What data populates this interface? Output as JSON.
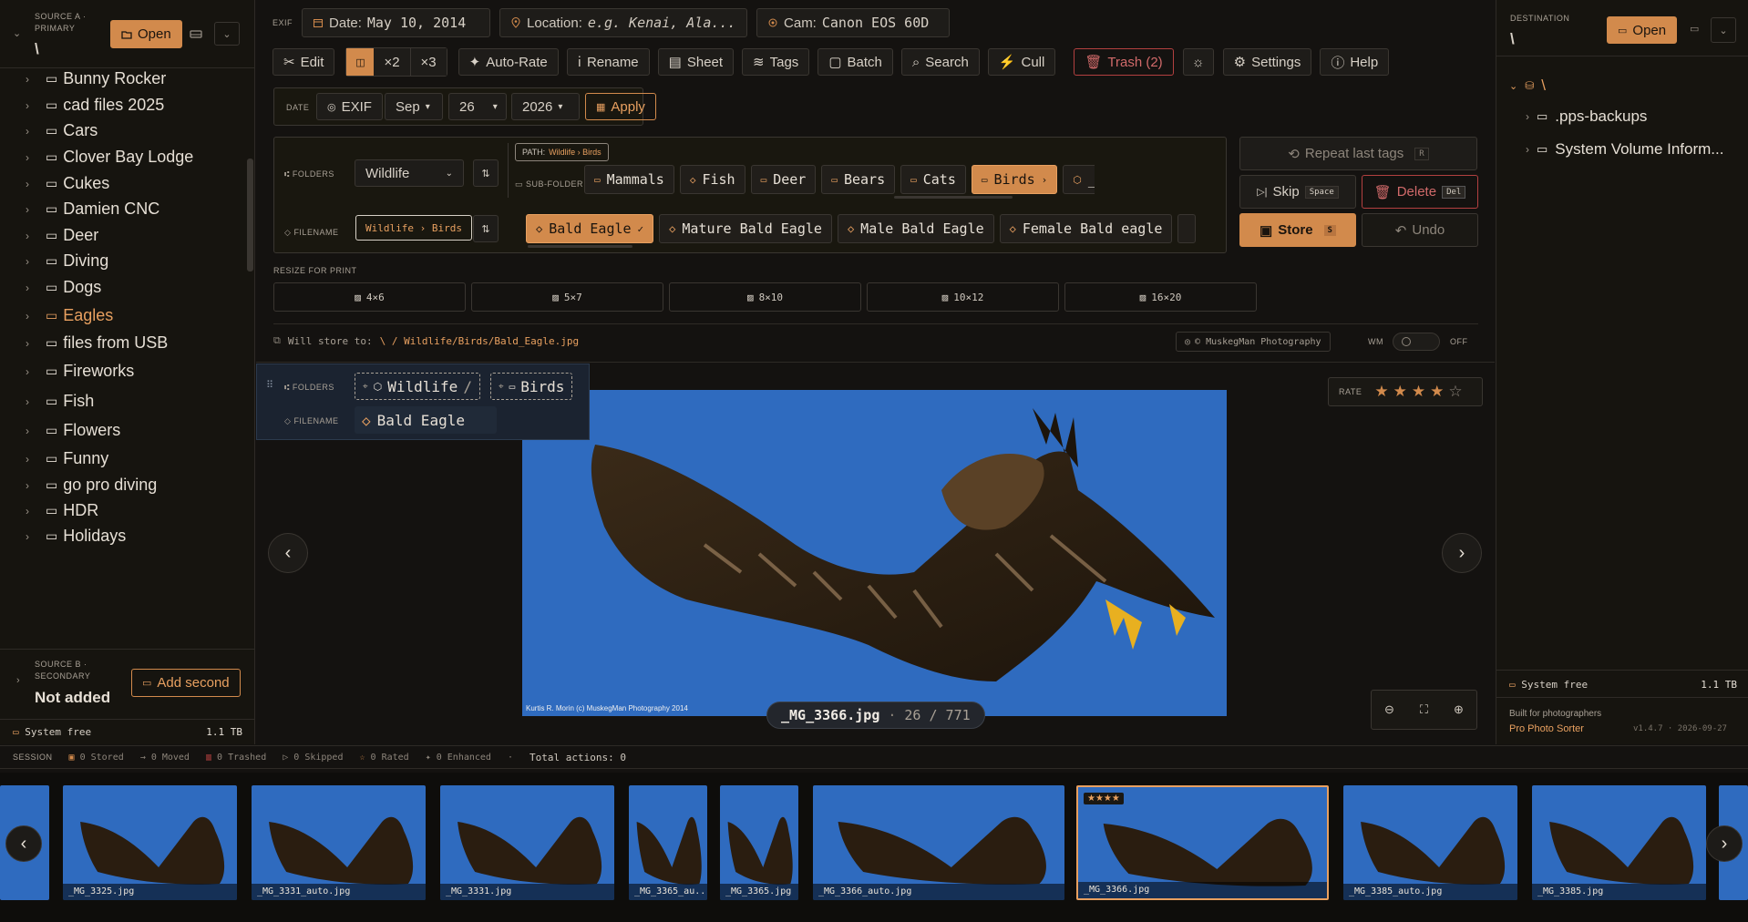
{
  "left": {
    "source_a_label": "SOURCE A · PRIMARY",
    "source_a_path": "\\",
    "open_label": "Open",
    "folders": [
      "Bunny Rocker",
      "cad files 2025",
      "Cars",
      "Clover Bay Lodge",
      "Cukes",
      "Damien CNC",
      "Deer",
      "Diving",
      "Dogs",
      "Eagles",
      "files from USB",
      "Fireworks",
      "Fish",
      "Flowers",
      "Funny",
      "go pro diving",
      "HDR",
      "Holidays"
    ],
    "active_folder": "Eagles",
    "source_b_label": "SOURCE B · SECONDARY",
    "source_b_value": "Not added",
    "add_second_label": "Add second",
    "free_label": "System free",
    "free_value": "1.1 TB"
  },
  "right": {
    "dest_label": "DESTINATION",
    "dest_path": "\\",
    "open_label": "Open",
    "root": "\\",
    "folders": [
      ".pps-backups",
      "System Volume Inform..."
    ],
    "free_label": "System free",
    "free_value": "1.1 TB",
    "built_for": "Built for photographers",
    "app_name": "Pro Photo Sorter",
    "version": "v1.4.7 · 2026-09-27"
  },
  "exif": {
    "label": "EXIF",
    "date_label": "Date:",
    "date_value": "May 10, 2014",
    "location_label": "Location:",
    "location_placeholder": "e.g. Kenai, Ala...",
    "cam_label": "Cam:",
    "cam_value": "Canon EOS 60D"
  },
  "toolbar": {
    "edit": "Edit",
    "x2": "×2",
    "x3": "×3",
    "autorate": "Auto-Rate",
    "rename": "Rename",
    "sheet": "Sheet",
    "tags": "Tags",
    "batch": "Batch",
    "search": "Search",
    "cull": "Cull",
    "trash": "Trash (2)",
    "settings": "Settings",
    "help": "Help"
  },
  "date_row": {
    "label": "DATE",
    "exif_btn": "EXIF",
    "month": "Sep",
    "day": "26",
    "year": "2026",
    "apply": "Apply"
  },
  "folders_panel": {
    "folders_label": "FOLDERS",
    "folder_select": "Wildlife",
    "path_label": "PATH:",
    "path_value": "Wildlife › Birds",
    "subfolder_label": "SUB-FOLDER",
    "subfolders": [
      "Mammals",
      "Fish",
      "Deer",
      "Bears",
      "Cats",
      "Birds",
      "_Unsorte"
    ],
    "selected_subfolder": "Birds",
    "filename_label": "FILENAME",
    "filename_path": "Wildlife › Birds",
    "names": [
      "Bald Eagle",
      "Mature Bald Eagle",
      "Male Bald Eagle",
      "Female Bald eagle"
    ],
    "selected_name": "Bald Eagle"
  },
  "actions": {
    "repeat": "Repeat last tags",
    "repeat_key": "R",
    "skip": "Skip",
    "skip_key": "Space",
    "delete": "Delete",
    "delete_key": "Del",
    "store": "Store",
    "store_key": "S",
    "undo": "Undo"
  },
  "resize": {
    "label": "RESIZE FOR PRINT",
    "sizes": [
      "4×6",
      "5×7",
      "8×10",
      "10×12",
      "16×20"
    ]
  },
  "store_line": {
    "label": "Will store to:",
    "path": "\\ / Wildlife/Birds/Bald_Eagle.jpg",
    "watermark": "© MuskegMan Photography",
    "wm": "WM",
    "off": "OFF"
  },
  "overlay": {
    "folders_label": "FOLDERS",
    "folder1": "Wildlife",
    "sep": "/",
    "folder2": "Birds",
    "filename_label": "FILENAME",
    "filename": "Bald Eagle"
  },
  "viewer": {
    "rate_label": "RATE",
    "rating": 4,
    "max_rating": 5,
    "photo_credit": "Kurtis R. Morin (c) MuskegMan Photography 2014",
    "filename": "_MG_3366.jpg",
    "position": "26 / 771"
  },
  "session": {
    "label": "SESSION",
    "stored": "0 Stored",
    "moved": "0 Moved",
    "trashed": "0 Trashed",
    "skipped": "0 Skipped",
    "rated": "0 Rated",
    "enhanced": "0 Enhanced",
    "total": "Total actions: 0"
  },
  "filmstrip": [
    {
      "name": "_MG_3325.jpg"
    },
    {
      "name": "_MG_3331_auto.jpg"
    },
    {
      "name": "_MG_3331.jpg"
    },
    {
      "name": "_MG_3365_au..."
    },
    {
      "name": "_MG_3365.jpg"
    },
    {
      "name": "_MG_3366_auto.jpg"
    },
    {
      "name": "_MG_3366.jpg",
      "stars": "★★★★"
    },
    {
      "name": "_MG_3385_auto.jpg"
    },
    {
      "name": "_MG_3385.jpg"
    }
  ],
  "colors": {
    "accent": "#d28a4c",
    "background": "#141210",
    "danger": "#b34040",
    "sky": "#2f6bbf"
  }
}
